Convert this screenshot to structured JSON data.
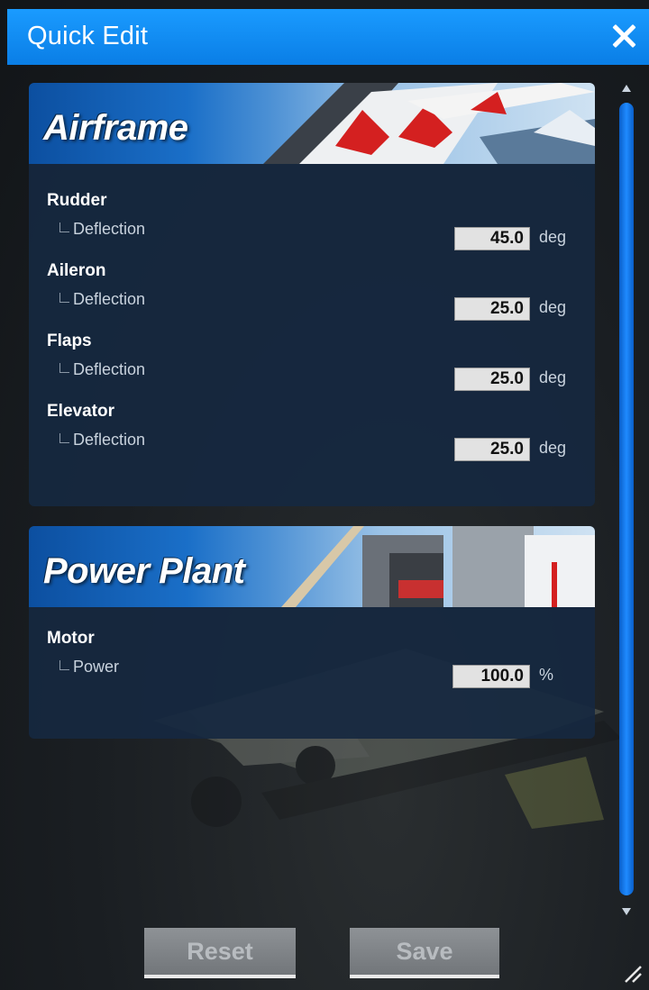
{
  "window": {
    "title": "Quick Edit",
    "accent_color": "#0a8af0"
  },
  "airframe": {
    "title": "Airframe",
    "rows": [
      {
        "group": "Rudder",
        "param": "Deflection",
        "value": "45.0",
        "unit": "deg"
      },
      {
        "group": "Aileron",
        "param": "Deflection",
        "value": "25.0",
        "unit": "deg"
      },
      {
        "group": "Flaps",
        "param": "Deflection",
        "value": "25.0",
        "unit": "deg"
      },
      {
        "group": "Elevator",
        "param": "Deflection",
        "value": "25.0",
        "unit": "deg"
      }
    ]
  },
  "power_plant": {
    "title": "Power Plant",
    "rows": [
      {
        "group": "Motor",
        "param": "Power",
        "value": "100.0",
        "unit": "%"
      }
    ]
  },
  "buttons": {
    "reset_label": "Reset",
    "save_label": "Save"
  },
  "icons": {
    "close": "close-icon",
    "scroll_up": "chevron-up-icon",
    "scroll_down": "chevron-down-icon",
    "resize": "resize-grip-icon"
  }
}
